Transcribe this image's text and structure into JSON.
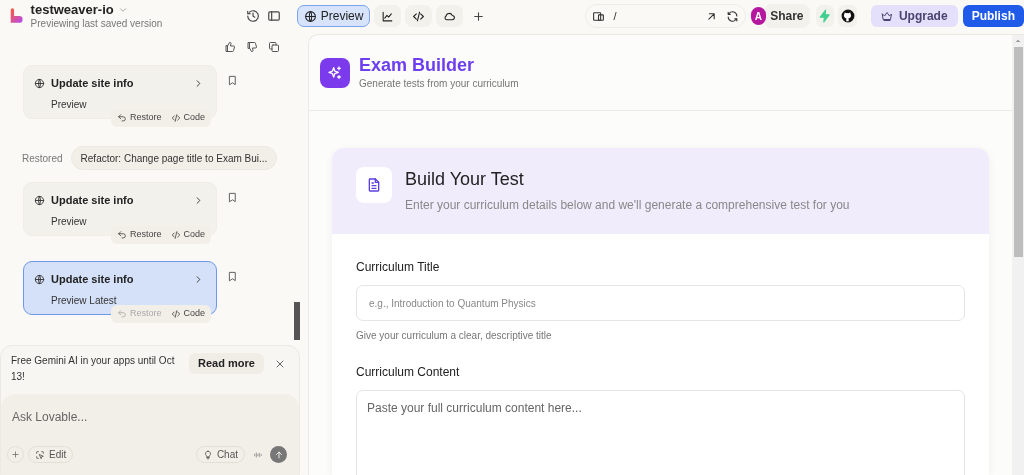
{
  "project": {
    "name": "testweaver-io",
    "status": "Previewing last saved version"
  },
  "view_tabs": [
    {
      "kind": "preview",
      "label": "Preview",
      "selected": true
    },
    {
      "kind": "analytics",
      "selected": false
    },
    {
      "kind": "code",
      "selected": false
    },
    {
      "kind": "cloud",
      "selected": false
    }
  ],
  "address": {
    "path": "/"
  },
  "avatar": {
    "initial": "A"
  },
  "actions": {
    "share": "Share",
    "upgrade": "Upgrade",
    "publish": "Publish"
  },
  "history": [
    {
      "kind": "version",
      "title": "Update site info",
      "subtitle": "Preview",
      "selected": false,
      "restore": "Restore",
      "restore_disabled": false,
      "code": "Code"
    },
    {
      "kind": "restored",
      "label": "Restored",
      "message": "Refactor: Change page title to Exam Bui..."
    },
    {
      "kind": "version",
      "title": "Update site info",
      "subtitle": "Preview",
      "selected": false,
      "restore": "Restore",
      "restore_disabled": false,
      "code": "Code"
    },
    {
      "kind": "version",
      "title": "Update site info",
      "subtitle": "Preview Latest",
      "selected": true,
      "restore": "Restore",
      "restore_disabled": true,
      "code": "Code"
    }
  ],
  "banner": {
    "text": "Free Gemini AI in your apps until Oct 13!",
    "button": "Read more"
  },
  "composer": {
    "placeholder": "Ask Lovable...",
    "edit": "Edit",
    "chat": "Chat"
  },
  "app": {
    "title": "Exam Builder",
    "subtitle": "Generate tests from your curriculum",
    "card": {
      "title": "Build Your Test",
      "description": "Enter your curriculum details below and we'll generate a comprehensive test for you",
      "fields": [
        {
          "kind": "input",
          "label": "Curriculum Title",
          "placeholder": "e.g., Introduction to Quantum Physics",
          "help": "Give your curriculum a clear, descriptive title"
        },
        {
          "kind": "textarea",
          "label": "Curriculum Content",
          "placeholder": "Paste your full curriculum content here..."
        }
      ]
    }
  }
}
